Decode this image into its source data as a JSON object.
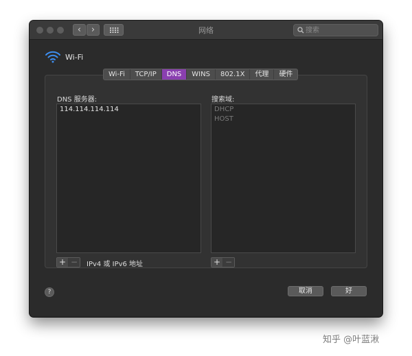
{
  "window": {
    "title": "网络",
    "search_placeholder": "搜索"
  },
  "network": {
    "name": "Wi-Fi"
  },
  "tabs": [
    {
      "label": "Wi-Fi"
    },
    {
      "label": "TCP/IP"
    },
    {
      "label": "DNS"
    },
    {
      "label": "WINS"
    },
    {
      "label": "802.1X"
    },
    {
      "label": "代理"
    },
    {
      "label": "硬件"
    }
  ],
  "dns": {
    "label": "DNS 服务器:",
    "servers": [
      "114.114.114.114"
    ],
    "hint": "IPv4 或 IPv6 地址"
  },
  "search_domains": {
    "label": "搜索域:",
    "items": [
      "DHCP",
      "HOST"
    ]
  },
  "controls": {
    "add": "+",
    "remove": "−",
    "help": "?",
    "cancel": "取消",
    "ok": "好"
  },
  "watermark": "知乎 @叶蓝湫",
  "colors": {
    "active_tab": "#8a3fb0",
    "window_bg": "#2b2b2b"
  }
}
